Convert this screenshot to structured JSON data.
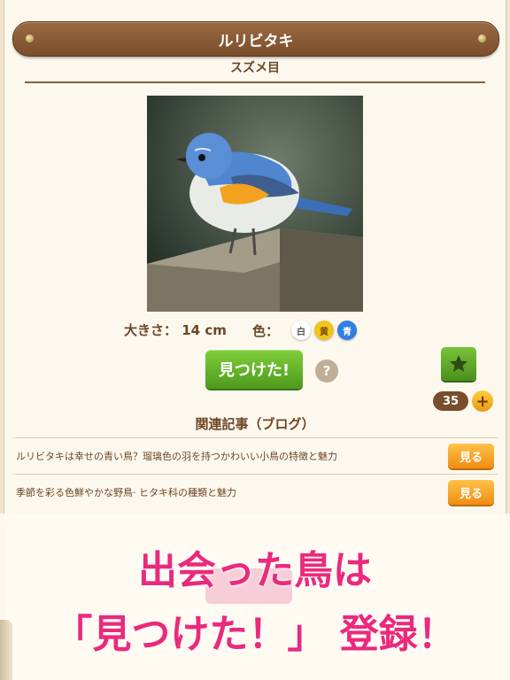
{
  "header": {
    "title": "ルリビタキ",
    "order": "スズメ目"
  },
  "photo": {
    "alt_icon": "bird-photo"
  },
  "info": {
    "size_label": "大きさ：",
    "size_value": "14 cm",
    "color_label": "色：",
    "colors": [
      {
        "label": "白",
        "bg": "#ffffff",
        "fg": "#555555"
      },
      {
        "label": "黄",
        "bg": "#f3c41f",
        "fg": "#7a4d00"
      },
      {
        "label": "青",
        "bg": "#2f7fe0",
        "fg": "#ffffff"
      }
    ]
  },
  "actions": {
    "found_label": "見つけた!",
    "help_label": "?",
    "count": "35",
    "plus_label": "+"
  },
  "related": {
    "heading": "関連記事（ブログ）",
    "articles": [
      {
        "text": "ルリビタキは幸せの青い鳥？瑠璃色の羽を持つかわいい小鳥の特徴と魅力",
        "button": "見る"
      },
      {
        "text": "季節を彩る色鮮やかな野鳥· ヒタキ科の種類と魅力",
        "button": "見る"
      }
    ]
  },
  "overlay": {
    "line1": "出会った鳥は",
    "line2": "「見つけた！」 登録！"
  },
  "colors": {
    "brand_brown": "#7a4d2b",
    "green": "#5aa823",
    "orange": "#f5a623",
    "pink": "#ea2a7b"
  }
}
